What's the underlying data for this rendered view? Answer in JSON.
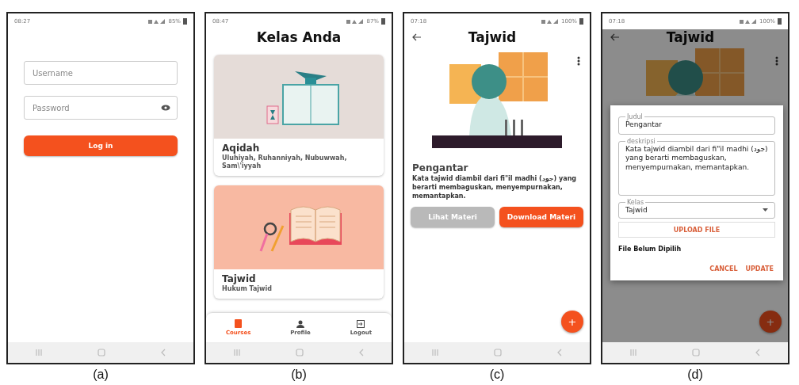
{
  "panels": [
    {
      "kind": "login",
      "caption": "(a)",
      "status": {
        "time": "08:27",
        "battery": "85%"
      },
      "username": {
        "placeholder": "Username"
      },
      "password": {
        "placeholder": "Password"
      },
      "login_button": "Log in"
    },
    {
      "kind": "courses",
      "caption": "(b)",
      "status": {
        "time": "08:47",
        "battery": "87%"
      },
      "title": "Kelas Anda",
      "courses": [
        {
          "title": "Aqidah",
          "subtitle": "Uluhiyah, Ruhanniyah, Nubuwwah, Sam\\'iyyah",
          "color": "#e5dcd8"
        },
        {
          "title": "Tajwid",
          "subtitle": "Hukum Tajwid",
          "color": "#f8b9a2"
        }
      ],
      "nav": [
        {
          "label": "Courses",
          "selected": true
        },
        {
          "label": "Profile",
          "selected": false
        },
        {
          "label": "Logout",
          "selected": false
        }
      ]
    },
    {
      "kind": "material",
      "caption": "(c)",
      "status": {
        "time": "07:18",
        "battery": "100%"
      },
      "title": "Tajwid",
      "heading": "Pengantar",
      "description": "Kata tajwid diambil dari fi\"il madhi (جود) yang berarti membaguskan, menyempurnakan, memantapkan.",
      "buttons": [
        {
          "label": "Lihat Materi",
          "disabled": true
        },
        {
          "label": "Download Materi",
          "disabled": false
        }
      ],
      "fab": "+"
    },
    {
      "kind": "edit_dialog",
      "caption": "(d)",
      "status": {
        "time": "07:18",
        "battery": "100%"
      },
      "title": "Tajwid",
      "fab": "+",
      "dialog": {
        "fields": [
          {
            "kind": "text",
            "label": "Judul",
            "value": "Pengantar"
          },
          {
            "kind": "textarea",
            "label": "deskripsi",
            "value": "Kata tajwid diambil dari fi\"il madhi (جود) yang berarti membaguskan, menyempurnakan, memantapkan."
          },
          {
            "kind": "select",
            "label": "Kelas",
            "value": "Tajwid"
          }
        ],
        "upload_button": "UPLOAD FILE",
        "file_status": "File Belum Dipilih",
        "actions": [
          "CANCEL",
          "UPDATE"
        ]
      }
    }
  ]
}
